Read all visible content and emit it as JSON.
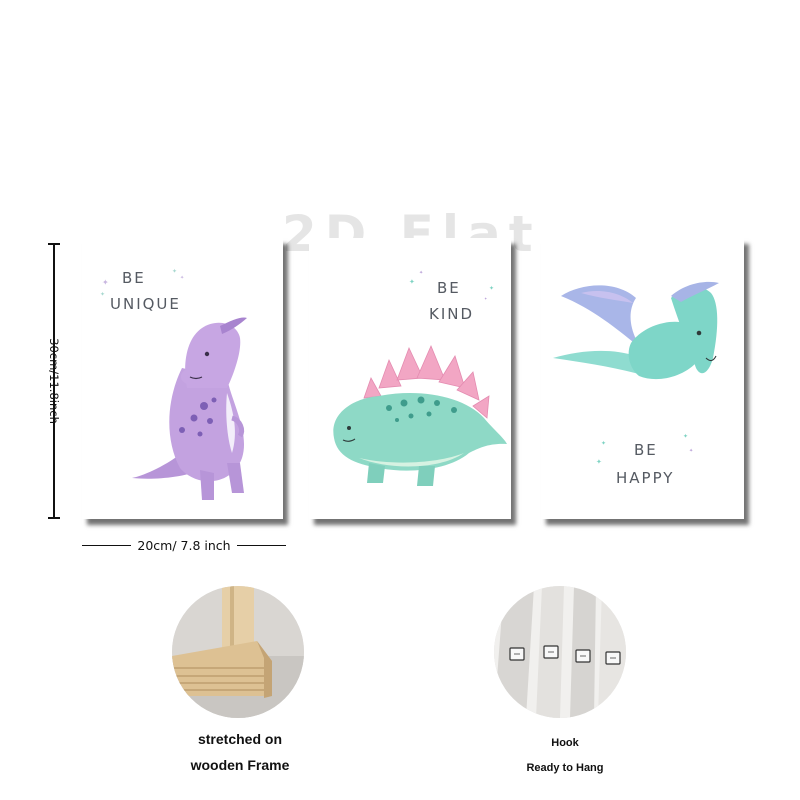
{
  "watermark": "2D Flat",
  "posters": [
    {
      "quote_line1": "BE",
      "quote_line2": "UNIQUE",
      "accent": "#b493d6"
    },
    {
      "quote_line1": "BE",
      "quote_line2": "KIND",
      "accent": "#7ed3c3"
    },
    {
      "quote_line1": "BE",
      "quote_line2": "HAPPY",
      "accent": "#6fd0c6"
    }
  ],
  "dimensions": {
    "height_label": "30cm/11.8inch",
    "width_label": "20cm/ 7.8 inch"
  },
  "features": {
    "frame_caption_line1": "stretched on",
    "frame_caption_line2": "wooden Frame",
    "hook_caption_line1": "Hook",
    "hook_caption_line2": "Ready to Hang"
  }
}
